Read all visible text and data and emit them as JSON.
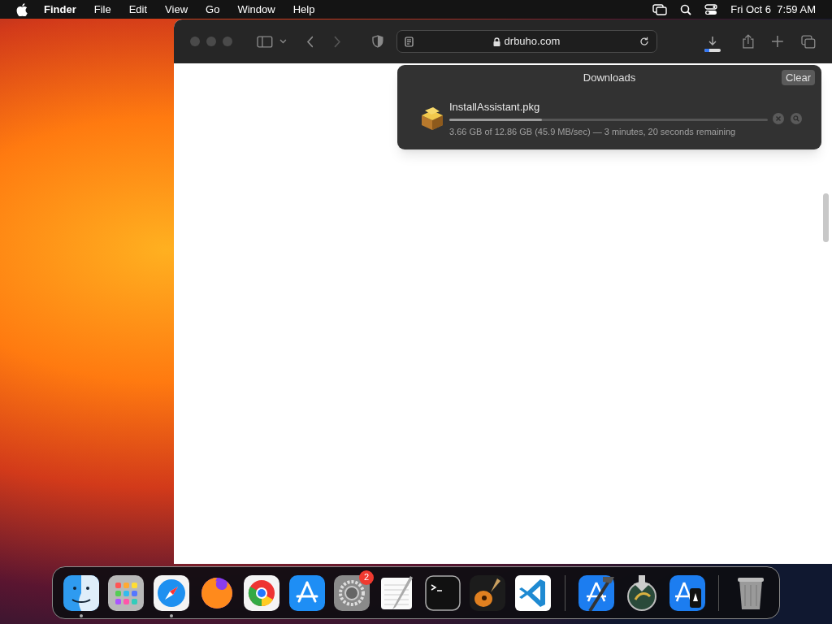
{
  "menu_bar": {
    "app": "Finder",
    "items": [
      "File",
      "Edit",
      "View",
      "Go",
      "Window",
      "Help"
    ],
    "clock": "Fri Oct 6  7:59 AM"
  },
  "browser": {
    "address": "drbuho.com"
  },
  "downloads": {
    "title": "Downloads",
    "clear_button": "Clear",
    "items": [
      {
        "name": "InstallAssistant.pkg",
        "level": 0.29,
        "status": "3.66 GB of 12.86 GB (45.9 MB/sec) — 3 minutes, 20 seconds remaining"
      }
    ]
  },
  "dock": {
    "items": [
      {
        "kind": "finder",
        "running": true
      },
      {
        "kind": "launchpad",
        "running": false
      },
      {
        "kind": "safari",
        "running": true
      },
      {
        "kind": "firefox",
        "running": false
      },
      {
        "kind": "chrome",
        "running": false
      },
      {
        "kind": "appstore",
        "running": false
      },
      {
        "kind": "settings",
        "running": false,
        "badge": "2"
      },
      {
        "kind": "textedit",
        "running": false
      },
      {
        "kind": "terminal",
        "running": false
      },
      {
        "kind": "garageband",
        "running": false
      },
      {
        "kind": "vscode",
        "running": false
      },
      {
        "kind": "separator"
      },
      {
        "kind": "xcode",
        "running": false
      },
      {
        "kind": "installer",
        "running": false
      },
      {
        "kind": "simulator",
        "running": false
      },
      {
        "kind": "separator"
      },
      {
        "kind": "trash",
        "running": false
      }
    ]
  }
}
